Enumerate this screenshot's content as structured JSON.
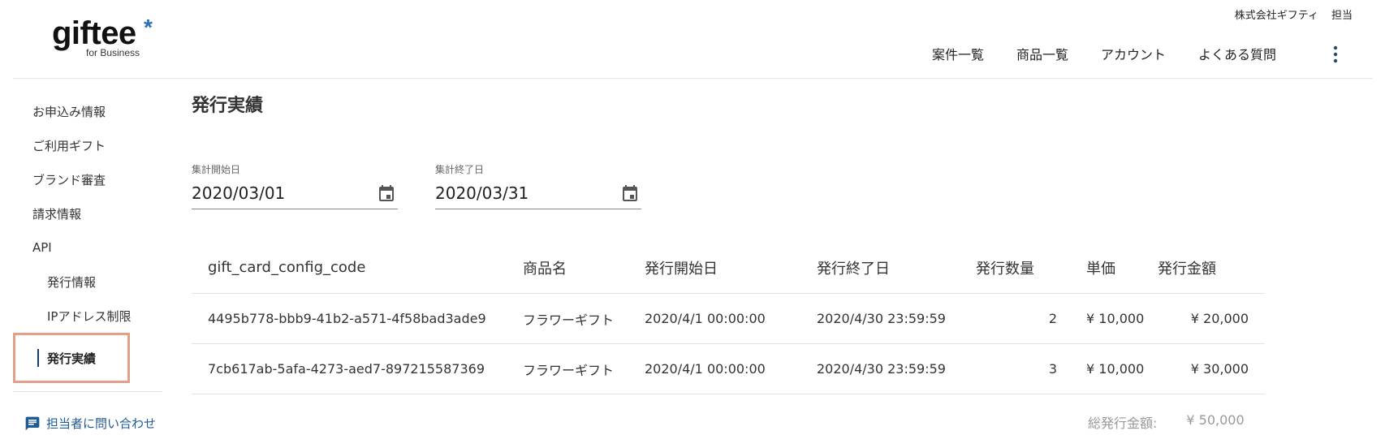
{
  "brand": {
    "logo_text": "giftee",
    "logo_mark": "*",
    "logo_sub": "for Business"
  },
  "header": {
    "company": "株式会社ギフティ",
    "role": "担当",
    "nav": [
      "案件一覧",
      "商品一覧",
      "アカウント",
      "よくある質問"
    ]
  },
  "sidebar": {
    "items": [
      {
        "label": "お申込み情報"
      },
      {
        "label": "ご利用ギフト"
      },
      {
        "label": "ブランド審査"
      },
      {
        "label": "請求情報"
      },
      {
        "label": "API"
      },
      {
        "label": "発行情報"
      },
      {
        "label": "IPアドレス制限"
      },
      {
        "label": "発行実績"
      }
    ],
    "contact": "担当者に問い合わせ"
  },
  "main": {
    "title": "発行実績",
    "start_date": {
      "label": "集計開始日",
      "value": "2020/03/01"
    },
    "end_date": {
      "label": "集計終了日",
      "value": "2020/03/31"
    },
    "table": {
      "headers": [
        "gift_card_config_code",
        "商品名",
        "発行開始日",
        "発行終了日",
        "発行数量",
        "単価",
        "発行金額"
      ],
      "rows": [
        [
          "4495b778-bbb9-41b2-a571-4f58bad3ade9",
          "フラワーギフト",
          "2020/4/1 00:00:00",
          "2020/4/30 23:59:59",
          "2",
          "¥ 10,000",
          "¥ 20,000"
        ],
        [
          "7cb617ab-5afa-4273-aed7-897215587369",
          "フラワーギフト",
          "2020/4/1 00:00:00",
          "2020/4/30 23:59:59",
          "3",
          "¥ 10,000",
          "¥ 30,000"
        ]
      ]
    },
    "total": {
      "label": "総発行金額:",
      "value": "¥ 50,000"
    }
  },
  "colors": {
    "accent": "#2b6fb6",
    "highlight_border": "#e0a08a",
    "link": "#1f5a94"
  },
  "icons": {
    "more": "more-vert-icon",
    "calendar": "calendar-icon",
    "chat": "chat-icon"
  }
}
